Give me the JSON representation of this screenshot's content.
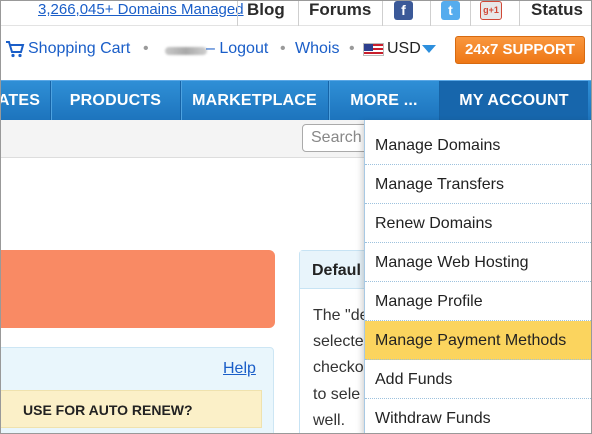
{
  "top": {
    "domains_managed": "3,266,045+ Domains Managed",
    "blog": "Blog",
    "forums": "Forums",
    "facebook_icon": "f",
    "twitter_icon": "t",
    "gplus_icon": "g+1",
    "status": "Status"
  },
  "account": {
    "cart": "Shopping Cart",
    "sep": "•",
    "logout": "– Logout",
    "whois": "Whois",
    "currency": "USD",
    "support": "24x7 SUPPORT"
  },
  "nav": {
    "items": [
      "ATES",
      "PRODUCTS",
      "MARKETPLACE",
      "MORE ...",
      "MY ACCOUNT"
    ]
  },
  "search": {
    "placeholder": "Search"
  },
  "content": {
    "default_title": "Defaul",
    "default_lines": [
      "The \"de",
      "selecte",
      "checko",
      "to sele",
      "well."
    ],
    "help": "Help",
    "auto_renew": "USE FOR AUTO RENEW?"
  },
  "dropdown": {
    "items": [
      "Manage Domains",
      "Manage Transfers",
      "Renew Domains",
      "Manage Web Hosting",
      "Manage Profile",
      "Manage Payment Methods",
      "Add Funds",
      "Withdraw Funds"
    ],
    "highlighted_index": 5
  },
  "colors": {
    "nav_blue": "#1d74bd",
    "support_orange": "#ee7716",
    "highlight_yellow": "#fbd45e",
    "alert_orange": "#f98a64"
  }
}
